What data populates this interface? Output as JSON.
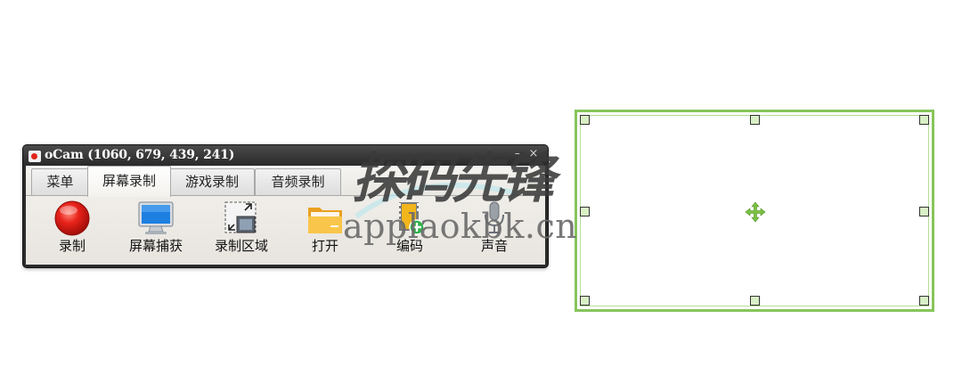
{
  "window": {
    "title": "oCam (1060, 679, 439, 241)",
    "minimize_glyph": "–",
    "close_glyph": "×"
  },
  "tabs": [
    {
      "label": "菜单",
      "active": false
    },
    {
      "label": "屏幕录制",
      "active": true
    },
    {
      "label": "游戏录制",
      "active": false
    },
    {
      "label": "音频录制",
      "active": false
    }
  ],
  "toolbar": [
    {
      "label": "录制",
      "icon": "record-icon"
    },
    {
      "label": "屏幕捕获",
      "icon": "monitor-icon"
    },
    {
      "label": "录制区域",
      "icon": "resize-area-icon"
    },
    {
      "label": "打开",
      "icon": "folder-icon"
    },
    {
      "label": "编码",
      "icon": "video-add-icon"
    },
    {
      "label": "声音",
      "icon": "microphone-icon"
    }
  ],
  "selection": {
    "icon": "move-icon",
    "border_color": "#86c55b"
  },
  "watermark": {
    "cn": "探码先锋",
    "en": "applaokbk.cn"
  }
}
